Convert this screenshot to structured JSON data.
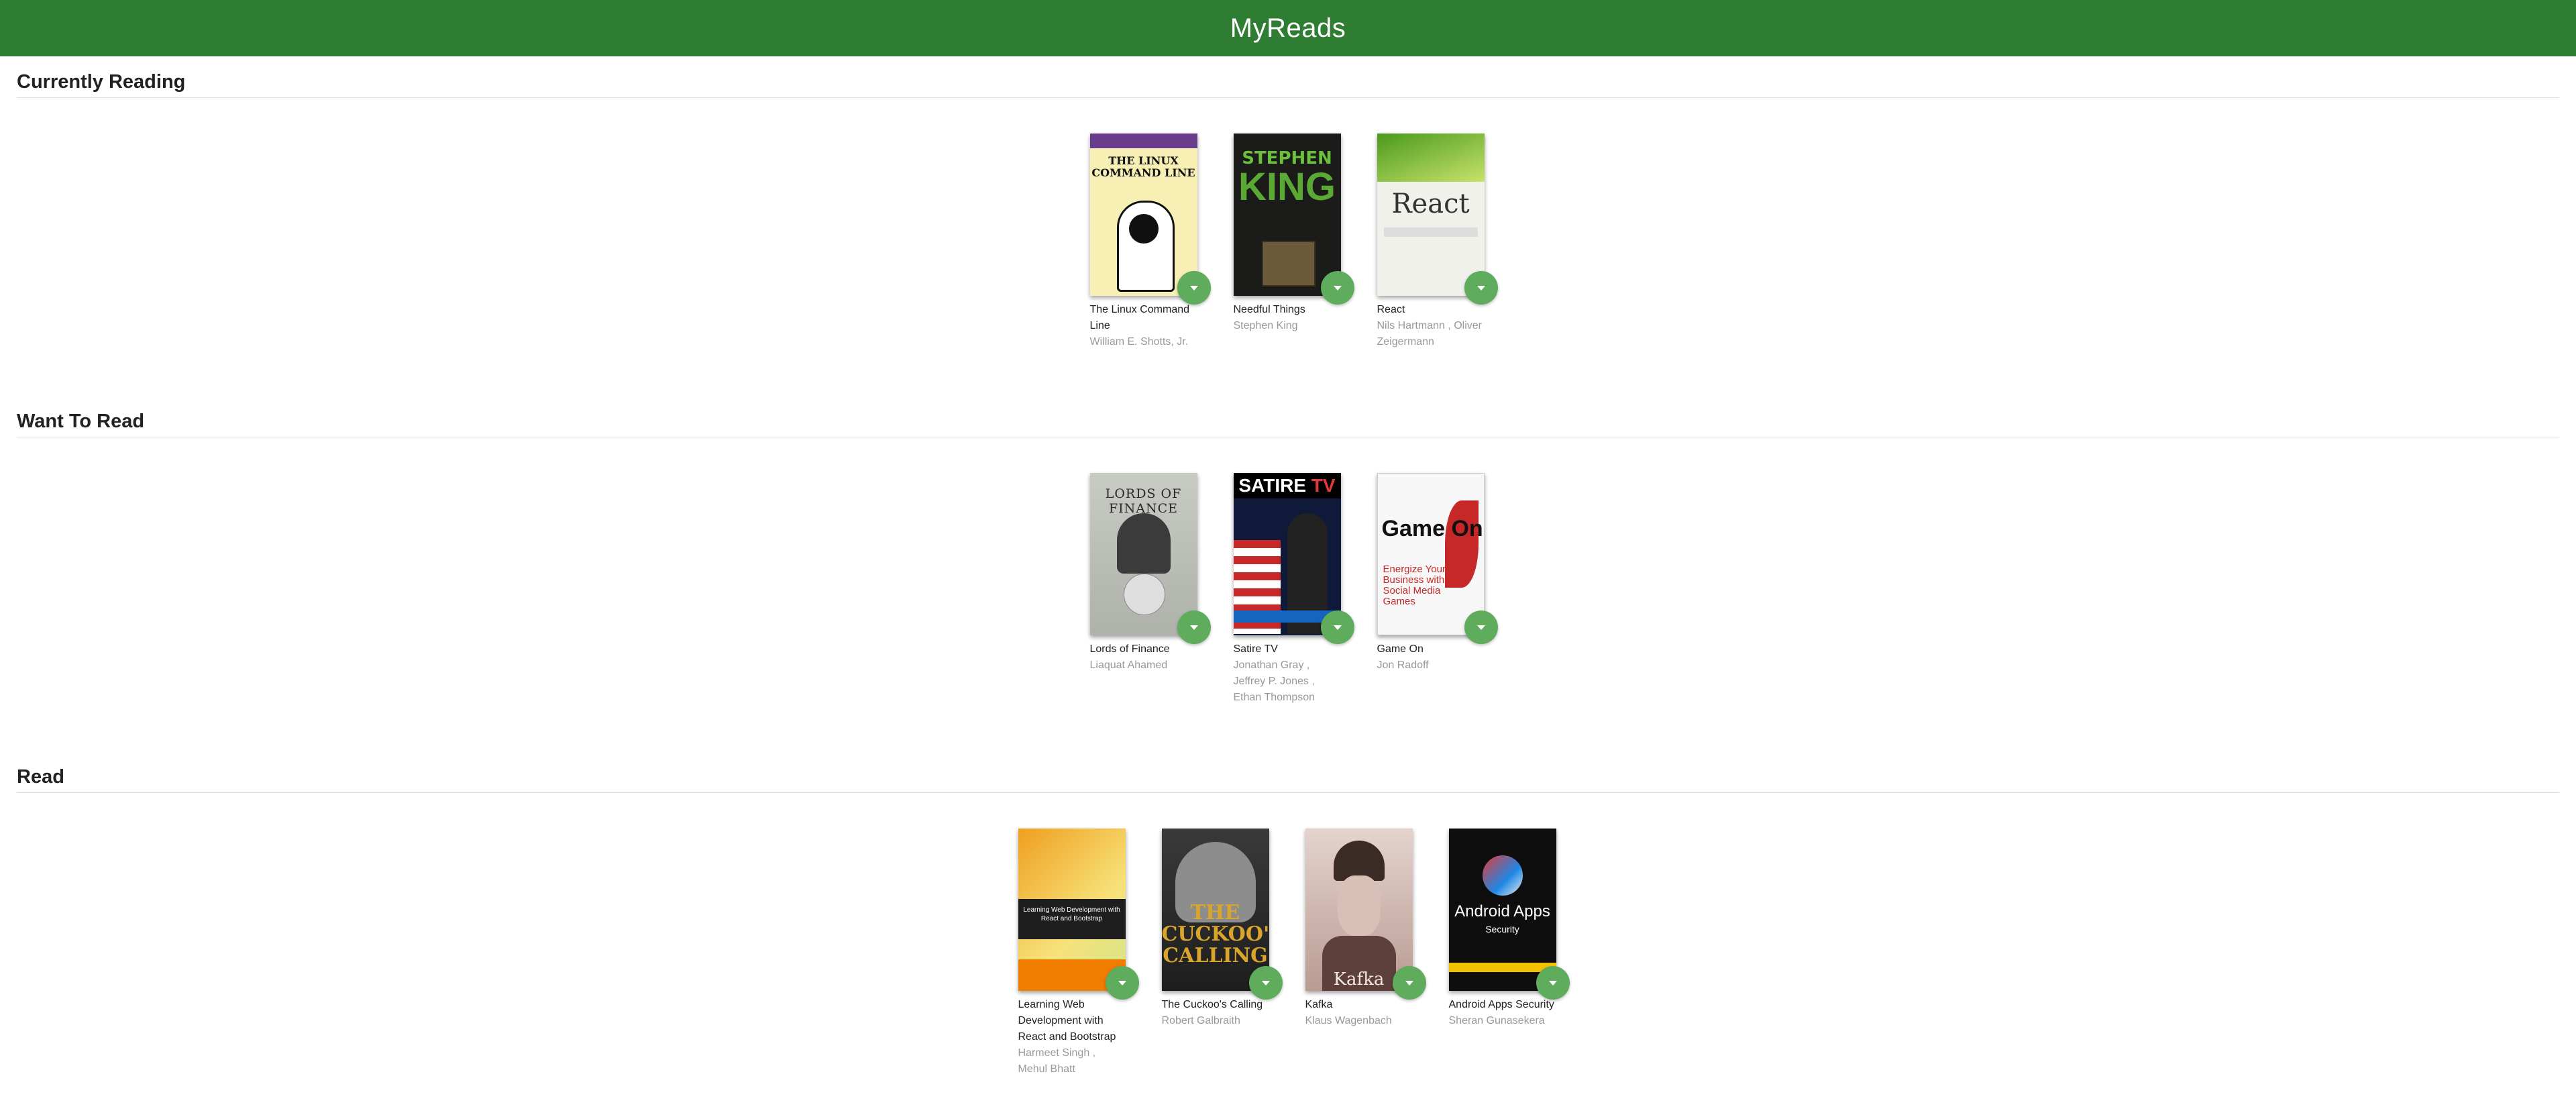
{
  "app": {
    "title": "MyReads"
  },
  "shelves": [
    {
      "title": "Currently Reading",
      "books": [
        {
          "title": "The Linux Command Line",
          "authors": "William E. Shotts, Jr.",
          "cover": "linux",
          "cover_text": [
            "THE LINUX",
            "COMMAND LINE"
          ]
        },
        {
          "title": "Needful Things",
          "authors": "Stephen King",
          "cover": "king",
          "cover_text": [
            "STEPHEN",
            "KING"
          ]
        },
        {
          "title": "React",
          "authors": "Nils Hartmann , Oliver Zeigermann",
          "cover": "react",
          "cover_text": [
            "React"
          ]
        }
      ]
    },
    {
      "title": "Want To Read",
      "books": [
        {
          "title": "Lords of Finance",
          "authors": "Liaquat Ahamed",
          "cover": "lords",
          "cover_text": [
            "LORDS OF FINANCE"
          ]
        },
        {
          "title": "Satire TV",
          "authors": "Jonathan Gray , Jeffrey P. Jones , Ethan Thompson",
          "cover": "satire",
          "cover_text": [
            "SATIRE",
            "TV"
          ]
        },
        {
          "title": "Game On",
          "authors": "Jon Radoff",
          "cover": "game",
          "cover_text": [
            "Game On",
            "Energize Your Business with Social Media Games"
          ]
        }
      ]
    },
    {
      "title": "Read",
      "books": [
        {
          "title": "Learning Web Development with React and Bootstrap",
          "authors": "Harmeet Singh , Mehul Bhatt",
          "cover": "lweb",
          "cover_text": [
            "Learning Web Development with React and Bootstrap"
          ]
        },
        {
          "title": "The Cuckoo's Calling",
          "authors": "Robert Galbraith",
          "cover": "cuckoo",
          "cover_text": [
            "THE CUCKOO'S CALLING"
          ]
        },
        {
          "title": "Kafka",
          "authors": "Klaus Wagenbach",
          "cover": "kafka",
          "cover_text": [
            "Kafka"
          ]
        },
        {
          "title": "Android Apps Security",
          "authors": "Sheran Gunasekera",
          "cover": "android",
          "cover_text": [
            "Android Apps",
            "Security"
          ]
        }
      ]
    }
  ],
  "colors": {
    "header_bg": "#2e7d32",
    "changer_bg": "#60ac5d",
    "author_text": "#999999"
  },
  "icons": {
    "shelf_changer": "caret-down-icon"
  }
}
